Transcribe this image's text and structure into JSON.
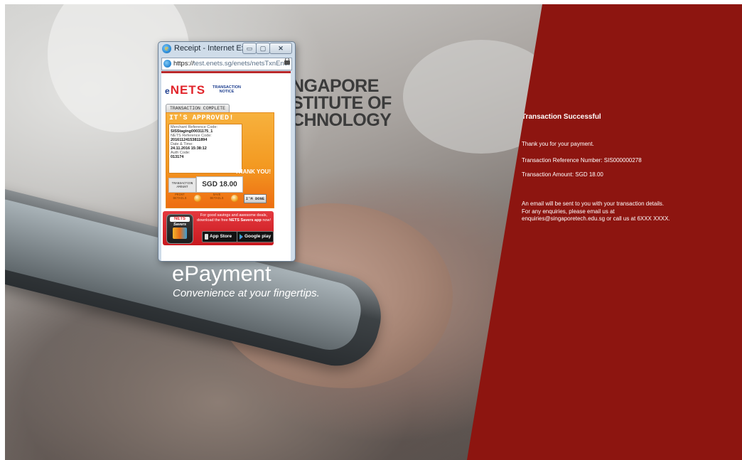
{
  "popup": {
    "window_title": "Receipt - Internet Expl...",
    "window_controls": {
      "minimize": "▭",
      "maximize": "▢",
      "close": "✕"
    },
    "address": {
      "prefix": "https://",
      "host": "test.enets.sg/enets/netsTxnEndI"
    },
    "receipt": {
      "brand_prefix": "e",
      "brand": "NETS",
      "notice": "TRANSACTION NOTICE",
      "tab": "TRANSACTION COMPLETE",
      "approved": "IT'S APPROVED!",
      "details": [
        {
          "label": "Merchant Reference Code:",
          "value": "SISStaging00031175_1"
        },
        {
          "label": "NETS Reference Code:",
          "value": "20161124153811894"
        },
        {
          "label": "Date & Time:",
          "value": "24.11.2016 15:38:12"
        },
        {
          "label": "Auth Code:",
          "value": "013174"
        }
      ],
      "thank_you": "THANK YOU!",
      "amount_label": "TRANSACTION AMOUNT",
      "amount": "SGD 18.00",
      "print_label": "PRINT DETAILS",
      "save_label": "SAVE DETAILS",
      "done_label": "I'M DONE",
      "savers_icon_top": "NETS",
      "savers_icon_bottom": "Savers",
      "promo_line1": "For good savings and awesome deals, download the free",
      "promo_bold": "NETS Savers app",
      "promo_end": "now!",
      "app_store": "App Store",
      "google_play": "Google play"
    }
  },
  "logo": {
    "line1": "NGAPORE",
    "line2": "STITUTE OF",
    "line3": "CHNOLOGY"
  },
  "hero": {
    "title": "ePayment",
    "tagline": "Convenience at your fingertips."
  },
  "panel": {
    "heading": "Transaction Successful",
    "thanks": "Thank you for your payment.",
    "reference": "Transaction Reference Number: SIS000000278",
    "amount": "Transaction Amount: SGD 18.00",
    "email_note": "An email will be sent to you with your transaction details. For any enquiries, please email us at enquiries@singaporetech.edu.sg or call us at 6XXX XXXX."
  },
  "colors": {
    "panel_red": "#8d1510",
    "nets_red": "#e1252b",
    "nets_blue": "#1d3e8f",
    "approved_orange": "#f39a22"
  }
}
